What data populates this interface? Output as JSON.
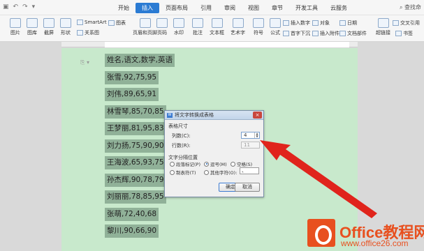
{
  "titlebar": {
    "tabs": [
      "开始",
      "插入",
      "页面布局",
      "引用",
      "审阅",
      "视图",
      "章节",
      "开发工具",
      "云服务"
    ],
    "active_tab": "插入",
    "search_label": "查找命"
  },
  "ribbon": {
    "big_buttons": [
      "图片",
      "图库",
      "截屏",
      "形状",
      "页眉和页脚",
      "页码",
      "水印",
      "批注",
      "文本框",
      "艺术字",
      "符号",
      "公式",
      "超链接",
      "书签"
    ],
    "small_buttons": [
      "SmartArt",
      "图表",
      "关系图",
      "插入数字",
      "对象",
      "日期",
      "首字下沉",
      "插入附件",
      "文档部件",
      "交叉引用"
    ]
  },
  "document": {
    "lines": [
      "姓名,语文,数学,英语",
      "张雪,92,75,95",
      "刘伟,89,65,91",
      "林雪琴,85,70,85",
      "王梦丽,81,95,83",
      "刘力扬,75,90,90",
      "王海波,65,93,75",
      "孙杰辉,90,78,79",
      "刘丽丽,78,85,95",
      "张萌,72,40,68",
      "黎川,90,66,90"
    ]
  },
  "dialog": {
    "title": "将文字转换成表格",
    "size_group": "表格尺寸",
    "columns_label": "列数(C):",
    "columns_value": "4",
    "rows_label": "行数(R):",
    "rows_value": "11",
    "separator_group": "文字分隔位置",
    "options": [
      "段落标记(P)",
      "逗号(M)",
      "空格(S)",
      "制表符(T)",
      "其他字符(O):"
    ],
    "selected_option": "逗号(M)",
    "other_char_value": "、",
    "ok_label": "确定",
    "cancel_label": "取消",
    "close_glyph": "×"
  },
  "watermark": {
    "line1": "Office教程网",
    "line2": "www.office26.com"
  },
  "colors": {
    "page": "#c8e9cc",
    "selection": "#90b198",
    "accent": "#2b7bd3",
    "arrow": "#e0241c",
    "brand": "#e8501f"
  }
}
